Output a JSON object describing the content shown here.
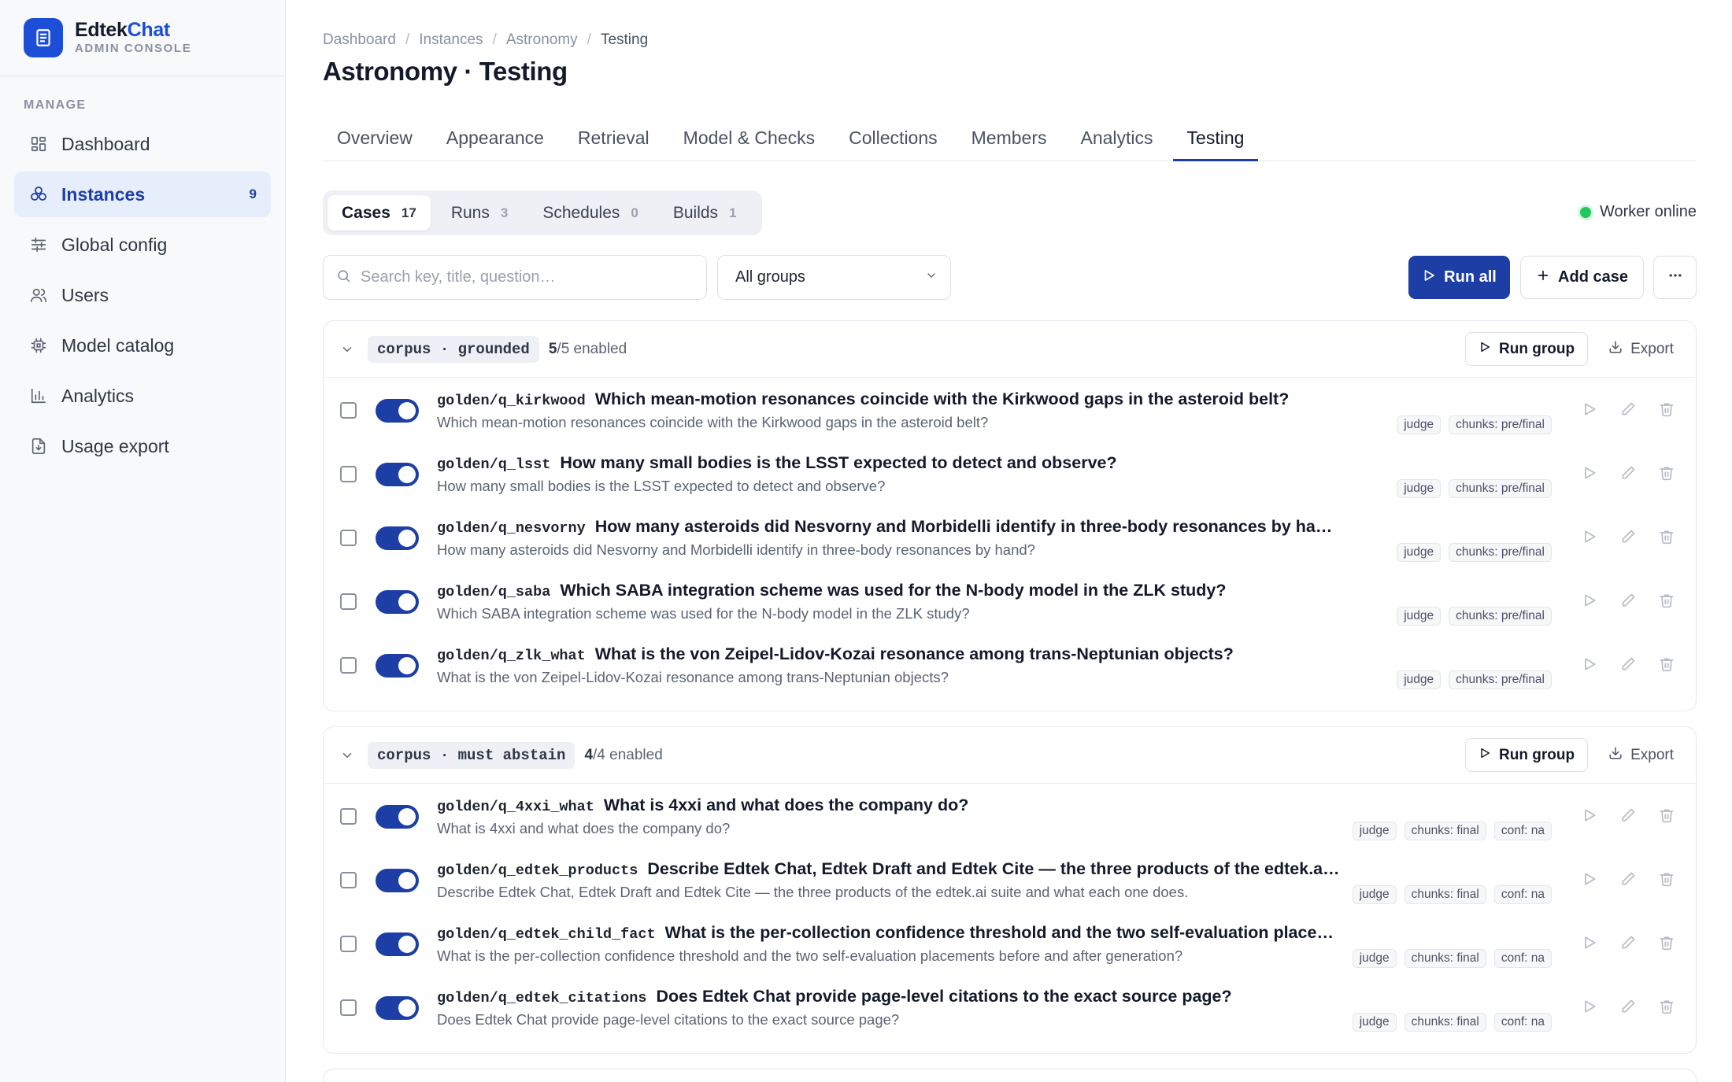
{
  "brand": {
    "name_main": "Edtek",
    "name_accent": "Chat",
    "subtitle": "ADMIN CONSOLE",
    "logo_icon": "document-icon",
    "accent_color": "#1d4ed8"
  },
  "sidebar": {
    "section_label": "MANAGE",
    "items": [
      {
        "label": "Dashboard",
        "icon": "grid-icon"
      },
      {
        "label": "Instances",
        "icon": "instances-icon",
        "count": "9",
        "active": true
      },
      {
        "label": "Global config",
        "icon": "sliders-icon"
      },
      {
        "label": "Users",
        "icon": "users-icon"
      },
      {
        "label": "Model catalog",
        "icon": "chip-icon"
      },
      {
        "label": "Analytics",
        "icon": "bar-chart-icon"
      },
      {
        "label": "Usage export",
        "icon": "file-export-icon"
      }
    ]
  },
  "breadcrumb": [
    "Dashboard",
    "Instances",
    "Astronomy",
    "Testing"
  ],
  "page_title": "Astronomy · Testing",
  "tabs": [
    "Overview",
    "Appearance",
    "Retrieval",
    "Model & Checks",
    "Collections",
    "Members",
    "Analytics",
    "Testing"
  ],
  "active_tab": "Testing",
  "subtabs": [
    {
      "label": "Cases",
      "count": "17",
      "active": true
    },
    {
      "label": "Runs",
      "count": "3"
    },
    {
      "label": "Schedules",
      "count": "0"
    },
    {
      "label": "Builds",
      "count": "1"
    }
  ],
  "worker_status": {
    "label": "Worker online",
    "color": "#22c55e"
  },
  "search": {
    "placeholder": "Search key, title, question…",
    "value": ""
  },
  "group_filter": {
    "selected": "All groups"
  },
  "toolbar": {
    "run_all": "Run all",
    "add_case": "Add case"
  },
  "groups": [
    {
      "tag": "corpus · grounded",
      "enabled_count": "5",
      "enabled_total": "/5 enabled",
      "run_group": "Run group",
      "export": "Export",
      "cases": [
        {
          "key": "golden/q_kirkwood",
          "title": "Which mean-motion resonances coincide with the Kirkwood gaps in the asteroid belt?",
          "question": "Which mean-motion resonances coincide with the Kirkwood gaps in the asteroid belt?",
          "chips": [
            "judge",
            "chunks: pre/final"
          ]
        },
        {
          "key": "golden/q_lsst",
          "title": "How many small bodies is the LSST expected to detect and observe?",
          "question": "How many small bodies is the LSST expected to detect and observe?",
          "chips": [
            "judge",
            "chunks: pre/final"
          ]
        },
        {
          "key": "golden/q_nesvorny",
          "title": "How many asteroids did Nesvorny and Morbidelli identify in three-body resonances by hand?",
          "question": "How many asteroids did Nesvorny and Morbidelli identify in three-body resonances by hand?",
          "chips": [
            "judge",
            "chunks: pre/final"
          ]
        },
        {
          "key": "golden/q_saba",
          "title": "Which SABA integration scheme was used for the N-body model in the ZLK study?",
          "question": "Which SABA integration scheme was used for the N-body model in the ZLK study?",
          "chips": [
            "judge",
            "chunks: pre/final"
          ]
        },
        {
          "key": "golden/q_zlk_what",
          "title": "What is the von Zeipel-Lidov-Kozai resonance among trans-Neptunian objects?",
          "question": "What is the von Zeipel-Lidov-Kozai resonance among trans-Neptunian objects?",
          "chips": [
            "judge",
            "chunks: pre/final"
          ]
        }
      ]
    },
    {
      "tag": "corpus · must abstain",
      "enabled_count": "4",
      "enabled_total": "/4 enabled",
      "run_group": "Run group",
      "export": "Export",
      "cases": [
        {
          "key": "golden/q_4xxi_what",
          "title": "What is 4xxi and what does the company do?",
          "question": "What is 4xxi and what does the company do?",
          "chips": [
            "judge",
            "chunks: final",
            "conf: na"
          ]
        },
        {
          "key": "golden/q_edtek_products",
          "title": "Describe Edtek Chat, Edtek Draft and Edtek Cite — the three products of the edtek.ai suite and what each one does.",
          "question": "Describe Edtek Chat, Edtek Draft and Edtek Cite — the three products of the edtek.ai suite and what each one does.",
          "chips": [
            "judge",
            "chunks: final",
            "conf: na"
          ]
        },
        {
          "key": "golden/q_edtek_child_fact",
          "title": "What is the per-collection confidence threshold and the two self-evaluation placements before and after generation?",
          "question": "What is the per-collection confidence threshold and the two self-evaluation placements before and after generation?",
          "chips": [
            "judge",
            "chunks: final",
            "conf: na"
          ]
        },
        {
          "key": "golden/q_edtek_citations",
          "title": "Does Edtek Chat provide page-level citations to the exact source page?",
          "question": "Does Edtek Chat provide page-level citations to the exact source page?",
          "chips": [
            "judge",
            "chunks: final",
            "conf: na"
          ]
        }
      ]
    }
  ]
}
